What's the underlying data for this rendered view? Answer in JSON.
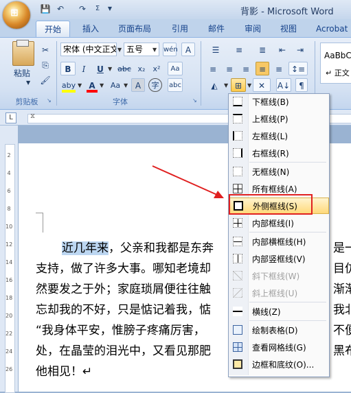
{
  "window": {
    "title": "背影 - Microsoft Word"
  },
  "quick_access": {
    "save": "💾",
    "undo": "↶",
    "redo": "↷"
  },
  "tabs": [
    "开始",
    "插入",
    "页面布局",
    "引用",
    "邮件",
    "审阅",
    "视图",
    "Acrobat"
  ],
  "clipboard": {
    "paste_label": "粘贴",
    "group_label": "剪贴板"
  },
  "font": {
    "name_value": "宋体 (中文正文",
    "size_value": "五号",
    "group_label": "字体",
    "bold": "B",
    "italic": "I",
    "underline": "U",
    "strike": "abc",
    "sub": "x₂",
    "sup": "x²",
    "grow": "A",
    "case": "Aa",
    "highlight": "aby",
    "font_color": "A",
    "shading": "A",
    "enclose": "字",
    "phonetic": "wén",
    "border_char": "A"
  },
  "styles": {
    "preview_text": "AaBbC",
    "preview_sub": "↵ 正文"
  },
  "document": {
    "lines": [
      {
        "highlight": "近几年来",
        "text": "，父亲和我都是东奔",
        "tail": "是一"
      },
      {
        "text": "支持，做了许多大事。哪知老境却",
        "tail": "目仿"
      },
      {
        "text": "然要发之于外；家庭琐屑便往往触",
        "tail": "渐渐"
      },
      {
        "text": "忘却我的不好，只是惦记着我，惦",
        "tail": "我北"
      },
      {
        "text": "“我身体平安，惟膀子疼痛厉害，",
        "tail": "不便"
      },
      {
        "text": "处，在晶莹的泪光中，又看见那肥",
        "tail": "黑布"
      },
      {
        "text": "他相见！↵"
      }
    ]
  },
  "menu": {
    "items": [
      {
        "label": "下框线(B)",
        "icon": "bottom-border-icon",
        "disabled": false
      },
      {
        "label": "上框线(P)",
        "icon": "top-border-icon",
        "disabled": false
      },
      {
        "label": "左框线(L)",
        "icon": "left-border-icon",
        "disabled": false
      },
      {
        "label": "右框线(R)",
        "icon": "right-border-icon",
        "disabled": false
      },
      {
        "label": "无框线(N)",
        "icon": "no-border-icon",
        "disabled": false
      },
      {
        "label": "所有框线(A)",
        "icon": "all-borders-icon",
        "disabled": false
      },
      {
        "label": "外侧框线(S)",
        "icon": "outside-borders-icon",
        "disabled": false,
        "hovered": true
      },
      {
        "label": "内部框线(I)",
        "icon": "inside-borders-icon",
        "disabled": false
      },
      {
        "label": "内部横框线(H)",
        "icon": "inside-horizontal-border-icon",
        "disabled": false
      },
      {
        "label": "内部竖框线(V)",
        "icon": "inside-vertical-border-icon",
        "disabled": false
      },
      {
        "label": "斜下框线(W)",
        "icon": "diagonal-down-border-icon",
        "disabled": true
      },
      {
        "label": "斜上框线(U)",
        "icon": "diagonal-up-border-icon",
        "disabled": true
      },
      {
        "label": "横线(Z)",
        "icon": "horizontal-line-icon",
        "disabled": false
      },
      {
        "label": "绘制表格(D)",
        "icon": "draw-table-icon",
        "disabled": false
      },
      {
        "label": "查看网格线(G)",
        "icon": "view-gridlines-icon",
        "disabled": false
      },
      {
        "label": "边框和底纹(O)...",
        "icon": "borders-shading-icon",
        "disabled": false
      }
    ]
  },
  "ruler": {
    "vertical_numbers": [
      "2",
      "4",
      "6",
      "8",
      "10",
      "12",
      "14",
      "16",
      "18",
      "20",
      "22",
      "24",
      "26"
    ]
  },
  "colors": {
    "highlight": "#ffff00",
    "font_red": "#ff0000",
    "annotation_red": "#e02020",
    "hover_gold": "#ffd97a"
  }
}
